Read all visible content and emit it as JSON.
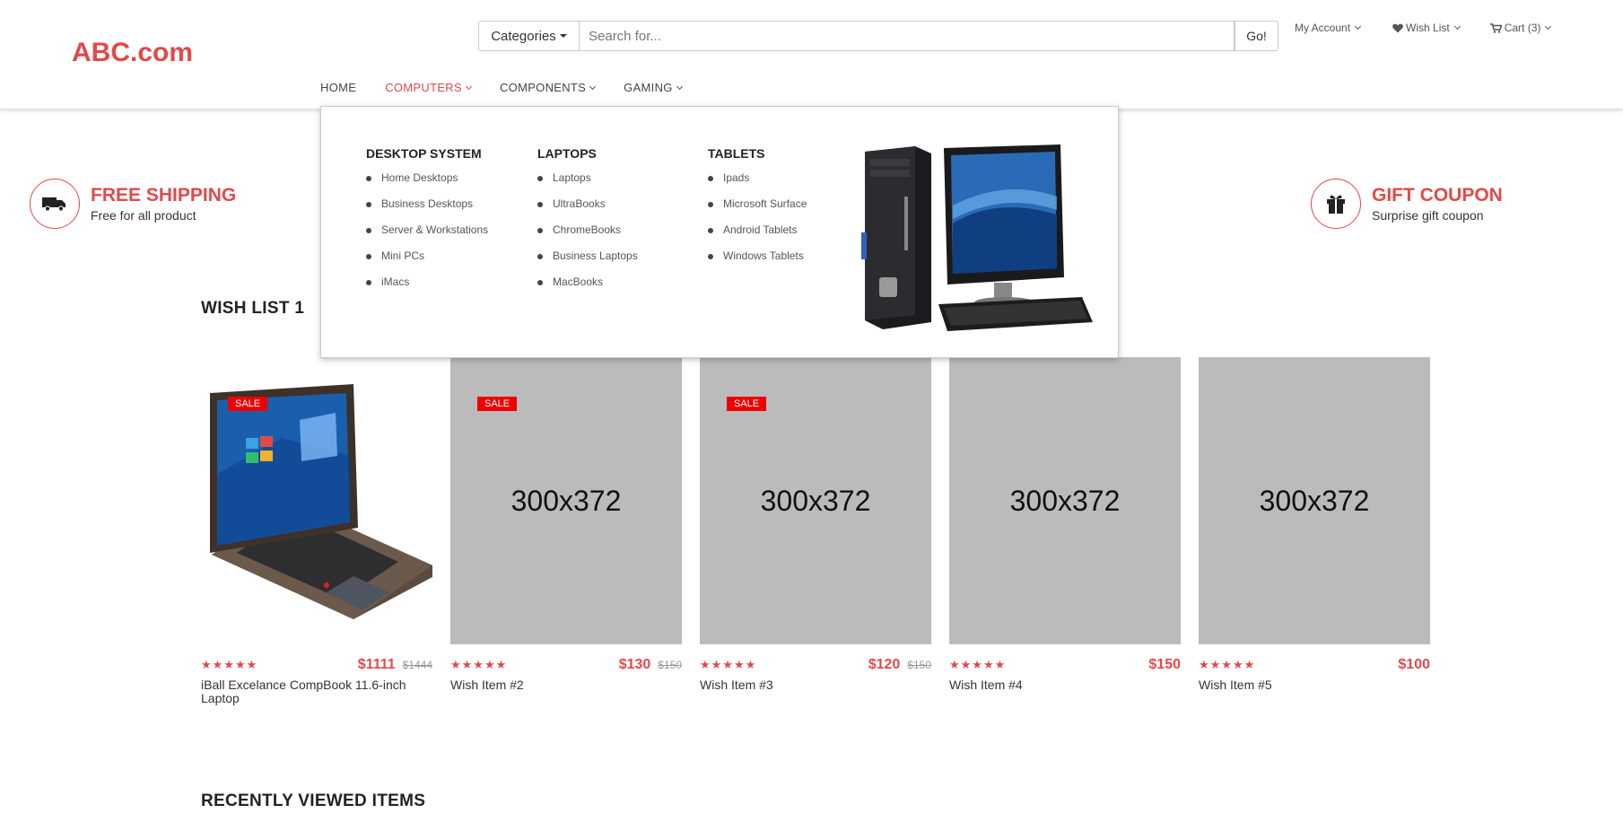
{
  "header": {
    "logo": "ABC.com",
    "categories_label": "Categories",
    "search_placeholder": "Search for...",
    "go_label": "Go!",
    "top_links": [
      {
        "label": "My Account",
        "icon": "user-chevron"
      },
      {
        "label": "Wish List",
        "icon": "heart-icon"
      },
      {
        "label": "Cart (3)",
        "icon": "cart-icon"
      }
    ]
  },
  "nav": {
    "items": [
      {
        "label": "HOME",
        "dropdown": false,
        "active": false
      },
      {
        "label": "COMPUTERS",
        "dropdown": true,
        "active": true
      },
      {
        "label": "COMPONENTS",
        "dropdown": true,
        "active": false
      },
      {
        "label": "GAMING",
        "dropdown": true,
        "active": false
      }
    ]
  },
  "mega_menu": {
    "columns": [
      {
        "title": "DESKTOP SYSTEM",
        "items": [
          "Home Desktops",
          "Business Desktops",
          "Server & Workstations",
          "Mini PCs",
          "iMacs"
        ]
      },
      {
        "title": "LAPTOPS",
        "items": [
          "Laptops",
          "UltraBooks",
          "ChromeBooks",
          "Business Laptops",
          "MacBooks"
        ]
      },
      {
        "title": "TABLETS",
        "items": [
          "Ipads",
          "Microsoft Surface",
          "Android Tablets",
          "Windows Tablets"
        ]
      }
    ]
  },
  "features": {
    "shipping": {
      "title": "FREE SHIPPING",
      "subtitle": "Free for all product"
    },
    "coupon": {
      "title": "GIFT COUPON",
      "subtitle": "Surprise gift coupon"
    }
  },
  "wishlist": {
    "title": "WISH LIST 1",
    "products": [
      {
        "name": "iBall Excelance CompBook 11.6-inch Laptop",
        "price": "$1111",
        "old_price": "$1444",
        "sale": "SALE",
        "placeholder": "",
        "rating": "★★★★★"
      },
      {
        "name": "Wish Item #2",
        "price": "$130",
        "old_price": "$150",
        "sale": "SALE",
        "placeholder": "300x372",
        "rating": "★★★★★"
      },
      {
        "name": "Wish Item #3",
        "price": "$120",
        "old_price": "$150",
        "sale": "SALE",
        "placeholder": "300x372",
        "rating": "★★★★★"
      },
      {
        "name": "Wish Item #4",
        "price": "$150",
        "old_price": "",
        "sale": "",
        "placeholder": "300x372",
        "rating": "★★★★★"
      },
      {
        "name": "Wish Item #5",
        "price": "$100",
        "old_price": "",
        "sale": "",
        "placeholder": "300x372",
        "rating": "★★★★★"
      }
    ]
  },
  "recently_viewed": {
    "title": "RECENTLY VIEWED ITEMS"
  },
  "colors": {
    "accent": "#e04a4a",
    "sale_badge": "#ee0000",
    "placeholder_bg": "#bbbbbb"
  }
}
